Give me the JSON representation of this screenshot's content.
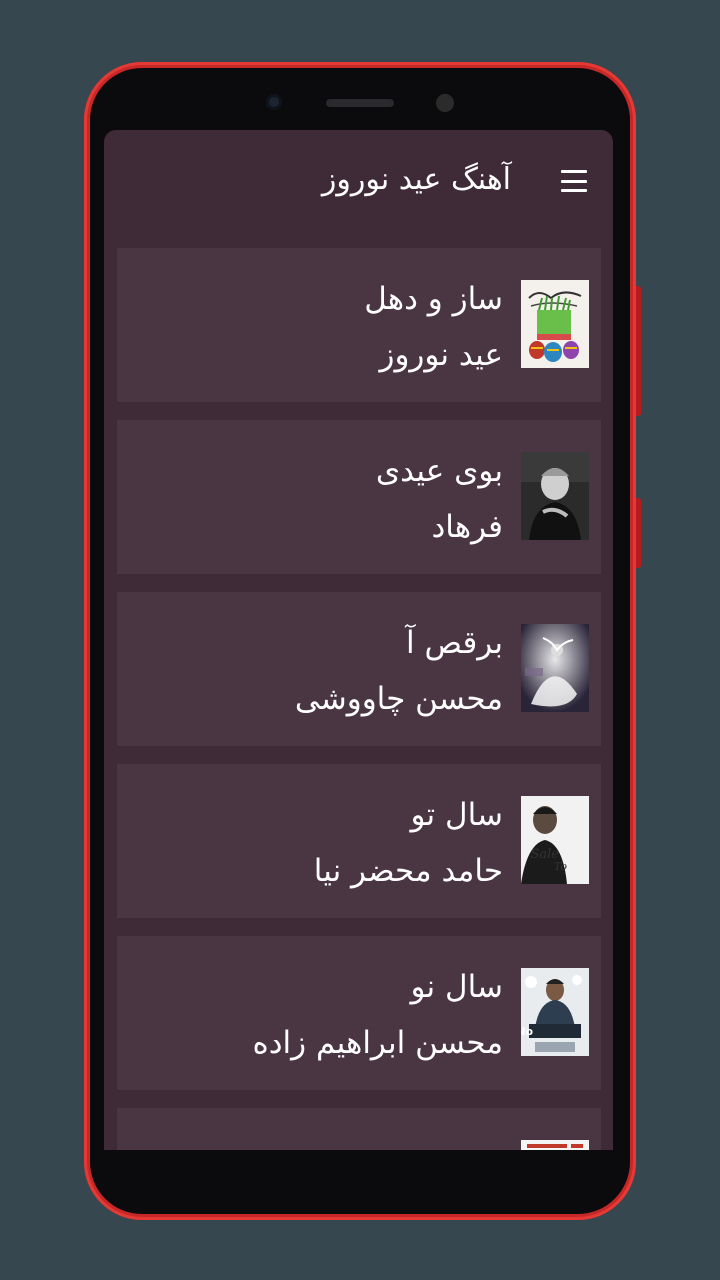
{
  "app": {
    "title": "آهنگ عید نوروز",
    "menu_icon": "hamburger-menu-icon"
  },
  "songs": [
    {
      "title": "ساز و دهل",
      "artist": "عید نوروز",
      "cover": "nowruz-sabzeh-cover"
    },
    {
      "title": "بوی عیدی",
      "artist": "فرهاد",
      "cover": "farhad-portrait-cover"
    },
    {
      "title": "برقص آ",
      "artist": "محسن چاووشی",
      "cover": "dancer-cover"
    },
    {
      "title": "سال تو",
      "artist": "حامد محضر نیا",
      "cover": "sale-to-cover"
    },
    {
      "title": "سال نو",
      "artist": "محسن ابراهیم زاده",
      "cover": "sale-no-cover"
    },
    {
      "title": "",
      "artist": "",
      "cover": "partial-cover"
    }
  ],
  "colors": {
    "background": "#37474f",
    "phone_frame": "#c62828",
    "screen": "#3f2a37",
    "card": "#4a3643",
    "text": "#ffffff"
  }
}
